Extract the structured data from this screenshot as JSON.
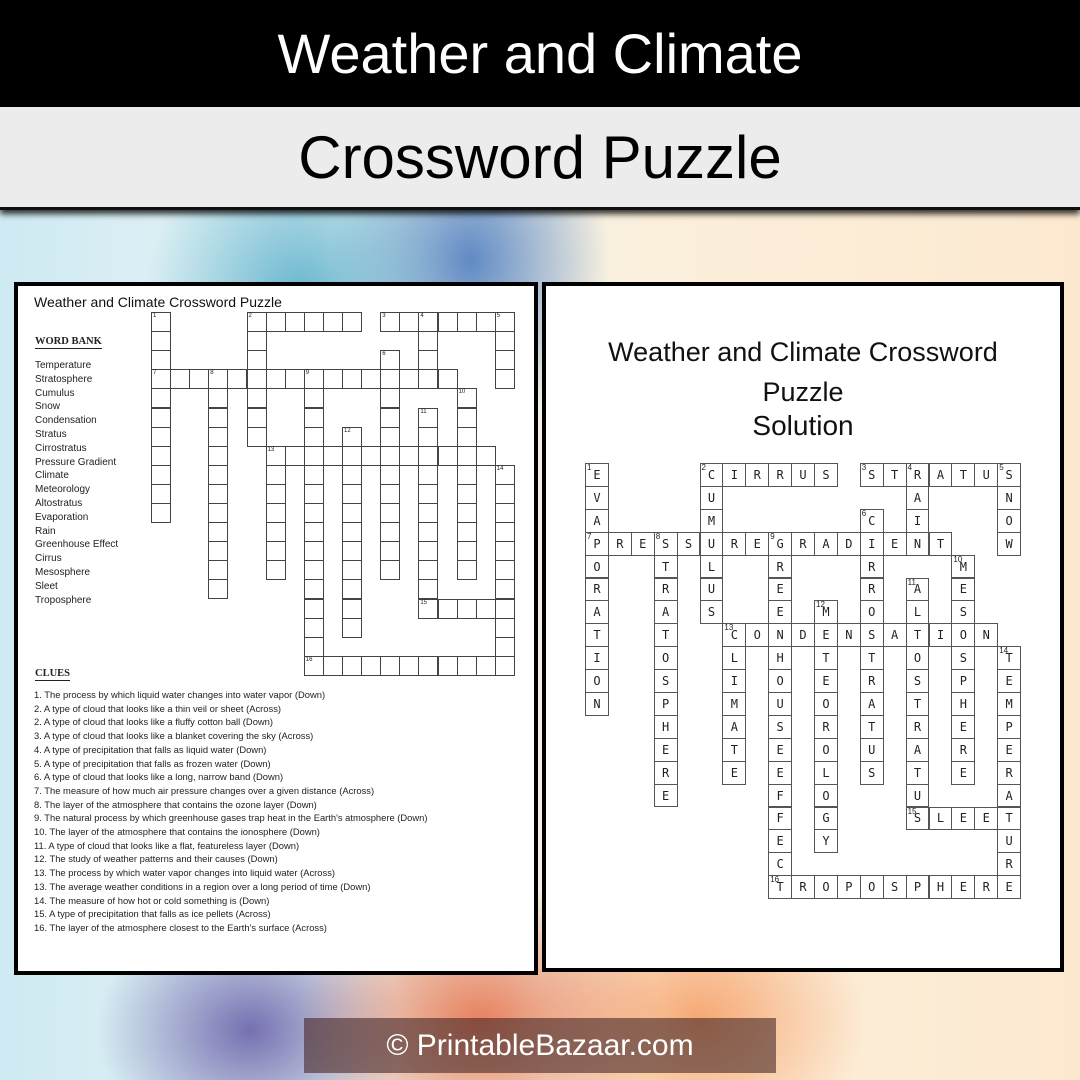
{
  "header": {
    "title": "Weather and Climate",
    "subtitle": "Crossword Puzzle"
  },
  "puzzle": {
    "title": "Weather and Climate Crossword Puzzle",
    "word_bank_heading": "WORD BANK",
    "word_bank": [
      "Temperature",
      "Stratosphere",
      "Cumulus",
      "Snow",
      "Condensation",
      "Stratus",
      "Cirrostratus",
      "Pressure Gradient",
      "Climate",
      "Meteorology",
      "Altostratus",
      "Evaporation",
      "Rain",
      "Greenhouse Effect",
      "Cirrus",
      "Mesosphere",
      "Sleet",
      "Troposphere"
    ],
    "clues_heading": "CLUES",
    "clues": [
      "1. The process by which liquid water changes into water vapor (Down)",
      "2. A type of cloud that looks like a thin veil or sheet (Across)",
      "2. A type of cloud that looks like a fluffy cotton ball (Down)",
      "3. A type of cloud that looks like a blanket covering the sky (Across)",
      "4. A type of precipitation that falls as liquid water (Down)",
      "5. A type of precipitation that falls as frozen water (Down)",
      "6. A type of cloud that looks like a long, narrow band (Down)",
      "7. The measure of how much air pressure changes over a given distance (Across)",
      "8. The layer of the atmosphere that contains the ozone layer (Down)",
      "9. The natural process by which greenhouse gases trap heat in the Earth's atmosphere (Down)",
      "10. The layer of the atmosphere that contains the ionosphere (Down)",
      "11. A type of cloud that looks like a flat, featureless layer (Down)",
      "12. The study of weather patterns and their causes (Down)",
      "13. The process by which water vapor changes into liquid water (Across)",
      "13. The average weather conditions in a region over a long period of time (Down)",
      "14. The measure of how hot or cold something is (Down)",
      "15. A type of precipitation that falls as ice pellets (Across)",
      "16. The layer of the atmosphere closest to the Earth's surface (Across)"
    ]
  },
  "solution": {
    "title": "Weather and Climate Crossword Puzzle",
    "subtitle": "Solution",
    "words": [
      {
        "num": 1,
        "word": "EVAPORATION",
        "dir": "down",
        "row": 0,
        "col": 0
      },
      {
        "num": 2,
        "word": "CIRRUS",
        "dir": "across",
        "row": 0,
        "col": 5
      },
      {
        "num": 2,
        "word": "CUMULUS",
        "dir": "down",
        "row": 0,
        "col": 5
      },
      {
        "num": 3,
        "word": "STRATUS",
        "dir": "across",
        "row": 0,
        "col": 12
      },
      {
        "num": 4,
        "word": "RAIN",
        "dir": "down",
        "row": 0,
        "col": 14
      },
      {
        "num": 5,
        "word": "SNOW",
        "dir": "down",
        "row": 0,
        "col": 18
      },
      {
        "num": 6,
        "word": "CIRROSTRATUS",
        "dir": "down",
        "row": 2,
        "col": 12
      },
      {
        "num": 7,
        "word": "PRESSUREGRADIENT",
        "dir": "across",
        "row": 3,
        "col": 0
      },
      {
        "num": 8,
        "word": "STRATOSPHERE",
        "dir": "down",
        "row": 3,
        "col": 3
      },
      {
        "num": 9,
        "word": "GREENHOUSEEFFECT",
        "dir": "down",
        "row": 3,
        "col": 8
      },
      {
        "num": 10,
        "word": "MESOSPHERE",
        "dir": "down",
        "row": 4,
        "col": 16
      },
      {
        "num": 11,
        "word": "ALTOSTRATUS",
        "dir": "down",
        "row": 5,
        "col": 14
      },
      {
        "num": 12,
        "word": "METEOROLOGY",
        "dir": "down",
        "row": 6,
        "col": 10
      },
      {
        "num": 13,
        "word": "CONDENSATION",
        "dir": "across",
        "row": 7,
        "col": 6
      },
      {
        "num": 13,
        "word": "CLIMATE",
        "dir": "down",
        "row": 7,
        "col": 6
      },
      {
        "num": 14,
        "word": "TEMPERATURE",
        "dir": "down",
        "row": 8,
        "col": 18
      },
      {
        "num": 15,
        "word": "SLEET",
        "dir": "across",
        "row": 15,
        "col": 14
      },
      {
        "num": 16,
        "word": "TROPOSPHERE",
        "dir": "across",
        "row": 18,
        "col": 8
      }
    ]
  },
  "footer": {
    "copyright": "© PrintableBazaar.com"
  }
}
